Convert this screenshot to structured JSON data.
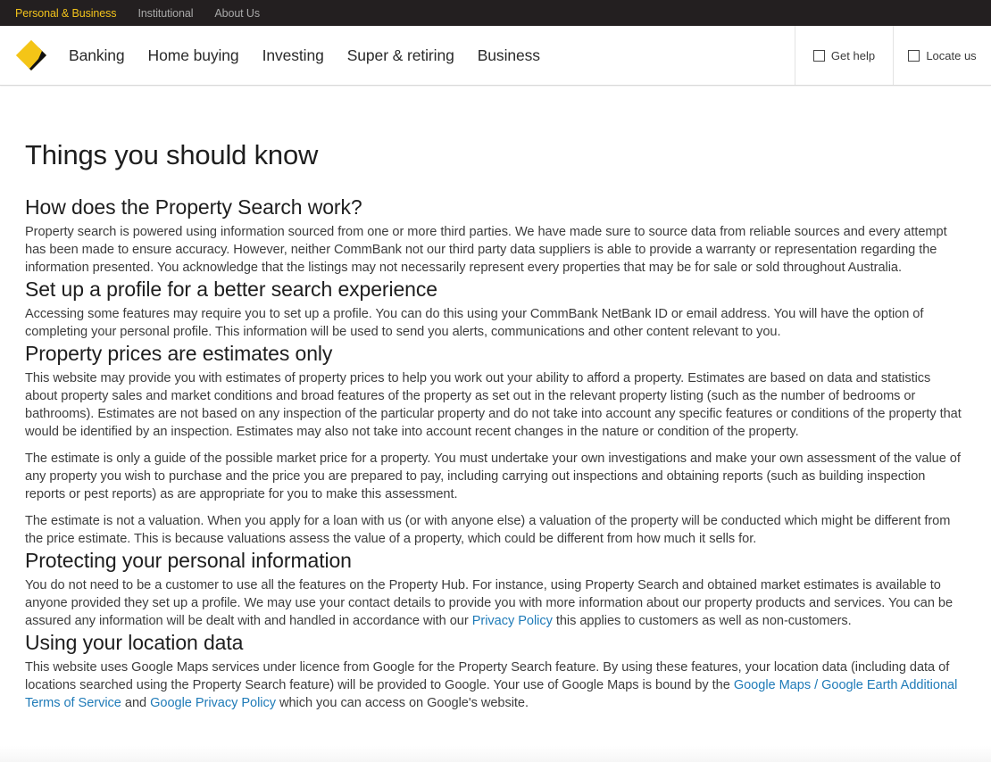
{
  "topbar": {
    "items": [
      {
        "label": "Personal & Business",
        "active": true
      },
      {
        "label": "Institutional",
        "active": false
      },
      {
        "label": "About Us",
        "active": false
      }
    ]
  },
  "brand": {
    "logo": "commbank-diamond-logo",
    "accent": "#f1c21b"
  },
  "nav": {
    "items": [
      "Banking",
      "Home buying",
      "Investing",
      "Super & retiring",
      "Business"
    ]
  },
  "utility": {
    "get_help": "Get help",
    "locate_us": "Locate us"
  },
  "page": {
    "title": "Things you should know",
    "sections": [
      {
        "heading": "How does the Property Search work?",
        "paragraphs": [
          "Property search is powered using information sourced from one or more third parties. We have made sure to source data from reliable sources and every attempt has been made to ensure accuracy. However, neither CommBank not our third party data suppliers is able to provide a warranty or representation regarding the information presented. You acknowledge that the listings may not necessarily represent every properties that may be for sale or sold throughout Australia."
        ]
      },
      {
        "heading": "Set up a profile for a better search experience",
        "paragraphs": [
          "Accessing some features may require you to set up a profile. You can do this using your CommBank NetBank ID or email address. You will have the option of completing your personal profile. This information will be used to send you alerts, communications and other content relevant to you."
        ]
      },
      {
        "heading": "Property prices are estimates only",
        "paragraphs": [
          "This website may provide you with estimates of property prices to help you work out your ability to afford a property. Estimates are based on data and statistics about property sales and market conditions and broad features of the property as set out in the relevant property listing (such as the number of bedrooms or bathrooms). Estimates are not based on any inspection of the particular property and do not take into account any specific features or conditions of the property that would be identified by an inspection. Estimates may also not take into account recent changes in the nature or condition of the property.",
          "The estimate is only a guide of the possible market price for a property. You must undertake your own investigations and make your own assessment of the value of any property you wish to purchase and the price you are prepared to pay, including carrying out inspections and obtaining reports (such as building inspection reports or pest reports) as are appropriate for you to make this assessment.",
          "The estimate is not a valuation. When you apply for a loan with us (or with anyone else) a valuation of the property will be conducted which might be different from the price estimate. This is because valuations assess the value of a property, which could be different from how much it sells for."
        ]
      },
      {
        "heading": "Protecting your personal information",
        "p1_before": "You do not need to be a customer to use all the features on the Property Hub. For instance, using Property Search and obtained market estimates is available to anyone provided they set up a profile. We may use your contact details to provide you with more information about our property products and services. You can be assured any information will be dealt with and handled in accordance with our ",
        "p1_link": "Privacy Policy",
        "p1_after": " this applies to customers as well as non-customers."
      },
      {
        "heading": "Using your location data",
        "p1_before": "This website uses Google Maps services under licence from Google for the Property Search feature. By using these features, your location data (including data of locations searched using the Property Search feature) will be provided to Google. Your use of Google Maps is bound by the ",
        "p1_link1": "Google Maps / Google Earth Additional Terms of Service",
        "p1_mid": " and ",
        "p1_link2": "Google Privacy Policy",
        "p1_after": " which you can access on Google's website."
      }
    ]
  },
  "colors": {
    "topbar_bg": "#231f20",
    "topbar_active": "#f1c21b",
    "link": "#1f7bb8"
  }
}
